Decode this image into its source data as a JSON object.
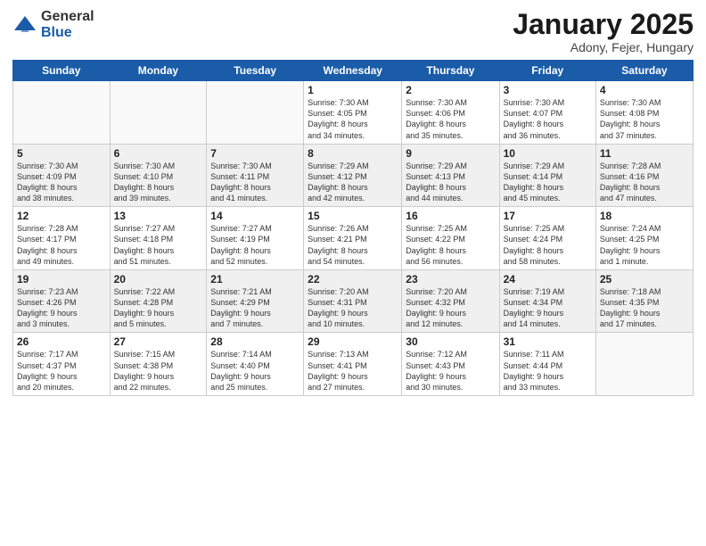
{
  "header": {
    "logo_general": "General",
    "logo_blue": "Blue",
    "title": "January 2025",
    "subtitle": "Adony, Fejer, Hungary"
  },
  "days_of_week": [
    "Sunday",
    "Monday",
    "Tuesday",
    "Wednesday",
    "Thursday",
    "Friday",
    "Saturday"
  ],
  "weeks": [
    [
      {
        "day": "",
        "info": ""
      },
      {
        "day": "",
        "info": ""
      },
      {
        "day": "",
        "info": ""
      },
      {
        "day": "1",
        "info": "Sunrise: 7:30 AM\nSunset: 4:05 PM\nDaylight: 8 hours\nand 34 minutes."
      },
      {
        "day": "2",
        "info": "Sunrise: 7:30 AM\nSunset: 4:06 PM\nDaylight: 8 hours\nand 35 minutes."
      },
      {
        "day": "3",
        "info": "Sunrise: 7:30 AM\nSunset: 4:07 PM\nDaylight: 8 hours\nand 36 minutes."
      },
      {
        "day": "4",
        "info": "Sunrise: 7:30 AM\nSunset: 4:08 PM\nDaylight: 8 hours\nand 37 minutes."
      }
    ],
    [
      {
        "day": "5",
        "info": "Sunrise: 7:30 AM\nSunset: 4:09 PM\nDaylight: 8 hours\nand 38 minutes."
      },
      {
        "day": "6",
        "info": "Sunrise: 7:30 AM\nSunset: 4:10 PM\nDaylight: 8 hours\nand 39 minutes."
      },
      {
        "day": "7",
        "info": "Sunrise: 7:30 AM\nSunset: 4:11 PM\nDaylight: 8 hours\nand 41 minutes."
      },
      {
        "day": "8",
        "info": "Sunrise: 7:29 AM\nSunset: 4:12 PM\nDaylight: 8 hours\nand 42 minutes."
      },
      {
        "day": "9",
        "info": "Sunrise: 7:29 AM\nSunset: 4:13 PM\nDaylight: 8 hours\nand 44 minutes."
      },
      {
        "day": "10",
        "info": "Sunrise: 7:29 AM\nSunset: 4:14 PM\nDaylight: 8 hours\nand 45 minutes."
      },
      {
        "day": "11",
        "info": "Sunrise: 7:28 AM\nSunset: 4:16 PM\nDaylight: 8 hours\nand 47 minutes."
      }
    ],
    [
      {
        "day": "12",
        "info": "Sunrise: 7:28 AM\nSunset: 4:17 PM\nDaylight: 8 hours\nand 49 minutes."
      },
      {
        "day": "13",
        "info": "Sunrise: 7:27 AM\nSunset: 4:18 PM\nDaylight: 8 hours\nand 51 minutes."
      },
      {
        "day": "14",
        "info": "Sunrise: 7:27 AM\nSunset: 4:19 PM\nDaylight: 8 hours\nand 52 minutes."
      },
      {
        "day": "15",
        "info": "Sunrise: 7:26 AM\nSunset: 4:21 PM\nDaylight: 8 hours\nand 54 minutes."
      },
      {
        "day": "16",
        "info": "Sunrise: 7:25 AM\nSunset: 4:22 PM\nDaylight: 8 hours\nand 56 minutes."
      },
      {
        "day": "17",
        "info": "Sunrise: 7:25 AM\nSunset: 4:24 PM\nDaylight: 8 hours\nand 58 minutes."
      },
      {
        "day": "18",
        "info": "Sunrise: 7:24 AM\nSunset: 4:25 PM\nDaylight: 9 hours\nand 1 minute."
      }
    ],
    [
      {
        "day": "19",
        "info": "Sunrise: 7:23 AM\nSunset: 4:26 PM\nDaylight: 9 hours\nand 3 minutes."
      },
      {
        "day": "20",
        "info": "Sunrise: 7:22 AM\nSunset: 4:28 PM\nDaylight: 9 hours\nand 5 minutes."
      },
      {
        "day": "21",
        "info": "Sunrise: 7:21 AM\nSunset: 4:29 PM\nDaylight: 9 hours\nand 7 minutes."
      },
      {
        "day": "22",
        "info": "Sunrise: 7:20 AM\nSunset: 4:31 PM\nDaylight: 9 hours\nand 10 minutes."
      },
      {
        "day": "23",
        "info": "Sunrise: 7:20 AM\nSunset: 4:32 PM\nDaylight: 9 hours\nand 12 minutes."
      },
      {
        "day": "24",
        "info": "Sunrise: 7:19 AM\nSunset: 4:34 PM\nDaylight: 9 hours\nand 14 minutes."
      },
      {
        "day": "25",
        "info": "Sunrise: 7:18 AM\nSunset: 4:35 PM\nDaylight: 9 hours\nand 17 minutes."
      }
    ],
    [
      {
        "day": "26",
        "info": "Sunrise: 7:17 AM\nSunset: 4:37 PM\nDaylight: 9 hours\nand 20 minutes."
      },
      {
        "day": "27",
        "info": "Sunrise: 7:15 AM\nSunset: 4:38 PM\nDaylight: 9 hours\nand 22 minutes."
      },
      {
        "day": "28",
        "info": "Sunrise: 7:14 AM\nSunset: 4:40 PM\nDaylight: 9 hours\nand 25 minutes."
      },
      {
        "day": "29",
        "info": "Sunrise: 7:13 AM\nSunset: 4:41 PM\nDaylight: 9 hours\nand 27 minutes."
      },
      {
        "day": "30",
        "info": "Sunrise: 7:12 AM\nSunset: 4:43 PM\nDaylight: 9 hours\nand 30 minutes."
      },
      {
        "day": "31",
        "info": "Sunrise: 7:11 AM\nSunset: 4:44 PM\nDaylight: 9 hours\nand 33 minutes."
      },
      {
        "day": "",
        "info": ""
      }
    ]
  ]
}
